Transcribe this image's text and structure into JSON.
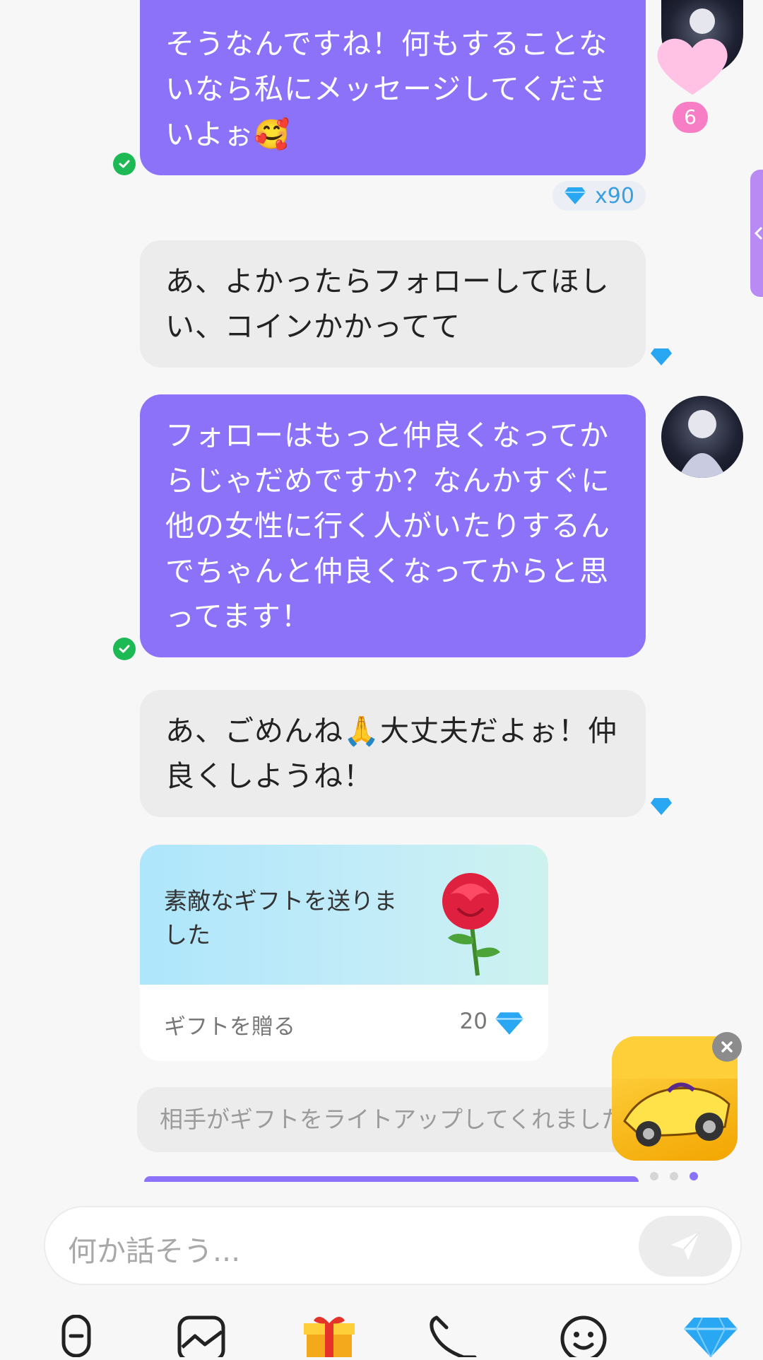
{
  "messages": {
    "m1": {
      "text": "そうなんですね！何もすることないなら私にメッセージしてくださいよぉ🥰"
    },
    "m1_cost": "x90",
    "m2": {
      "text": "あ、よかったらフォローしてほしい、コインかかってて"
    },
    "m3": {
      "text": "フォローはもっと仲良くなってからじゃだめですか？なんかすぐに他の女性に行く人がいたりするんでちゃんと仲良くなってからと思ってます！"
    },
    "m4": {
      "text": "あ、ごめんね🙏大丈夫だよぉ！仲良くしようね！"
    }
  },
  "avatar_badge": "6",
  "gift_card": {
    "message": "素敵なギフトを送りました",
    "send_label": "ギフトを贈る",
    "price": "20"
  },
  "system_message": "相手がギフトをライトアップしてくれました",
  "input": {
    "placeholder": "何か話そう..."
  },
  "colors": {
    "accent": "#8c72f9",
    "incoming": "#ececed",
    "check": "#1db954",
    "diamond": "#2aa7f2",
    "badge": "#f77dc4"
  },
  "toolbar": {
    "icons": [
      "voice-icon",
      "image-icon",
      "gift-icon",
      "phone-icon",
      "emoji-icon",
      "diamond-icon"
    ]
  },
  "carousel": {
    "pages": 3,
    "active": 3
  }
}
